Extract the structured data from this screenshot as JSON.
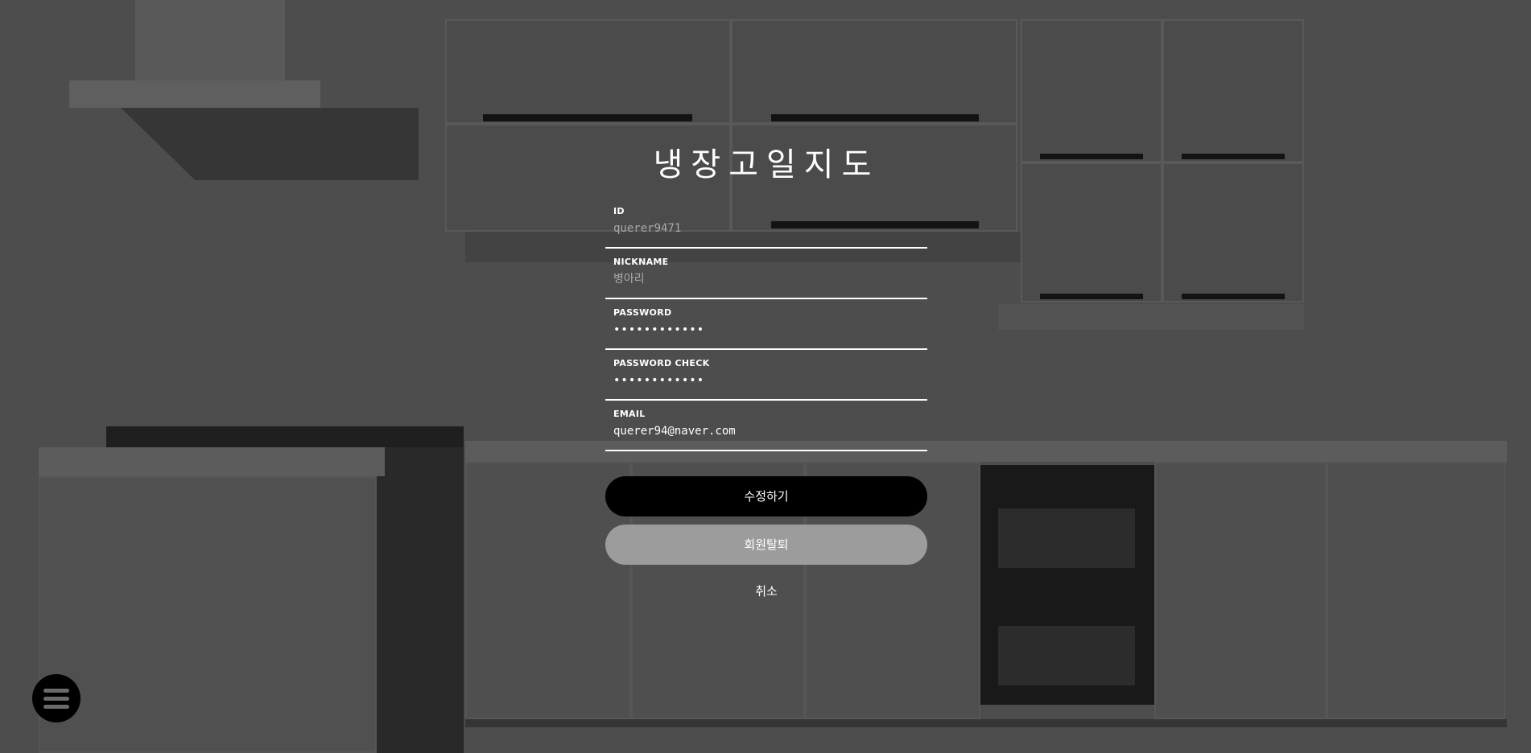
{
  "app": {
    "title": "냉장고일지도"
  },
  "form": {
    "fields": [
      {
        "label": "ID",
        "value": "",
        "placeholder": "querer9471",
        "type": "text"
      },
      {
        "label": "NICKNAME",
        "value": "",
        "placeholder": "병아리",
        "type": "text"
      },
      {
        "label": "PASSWORD",
        "value": "••••••••••••",
        "placeholder": "",
        "type": "text"
      },
      {
        "label": "PASSWORD CHECK",
        "value": "••••••••••••",
        "placeholder": "",
        "type": "text"
      },
      {
        "label": "EMAIL",
        "value": "querer94@naver.com",
        "placeholder": "",
        "type": "text"
      }
    ],
    "submit_label": "수정하기",
    "withdraw_label": "회원탈퇴",
    "cancel_label": "취소"
  },
  "menu": {
    "icon": "hamburger-menu-icon"
  },
  "colors": {
    "primary_button": "#000000",
    "secondary_button": "#9c9c9c",
    "text": "#ffffff"
  }
}
